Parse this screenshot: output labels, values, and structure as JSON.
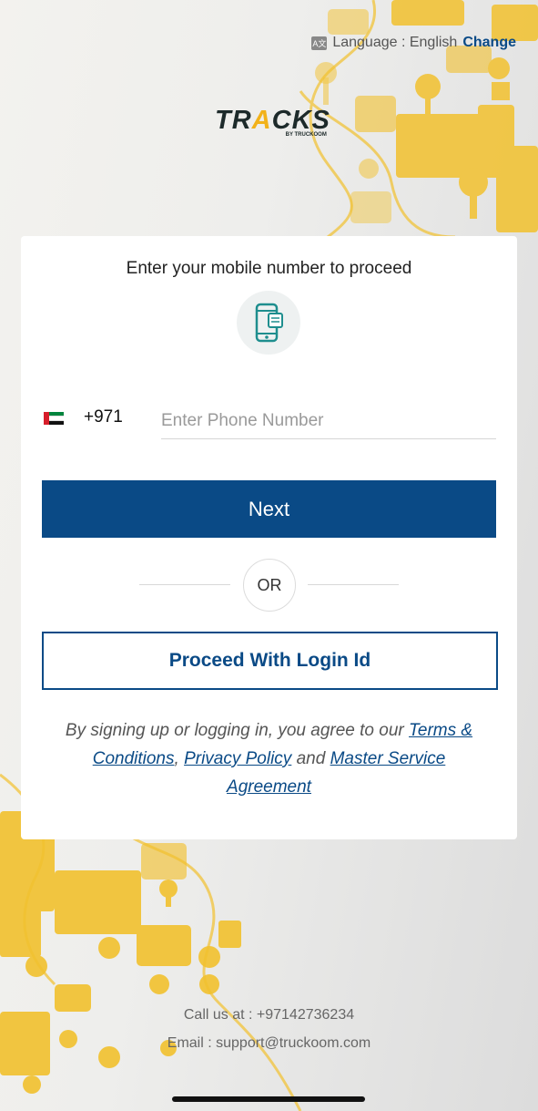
{
  "language": {
    "label": "Language : English",
    "change_label": "Change",
    "icon": "translate-icon"
  },
  "brand": {
    "word_pre": "TR",
    "word_a": "A",
    "word_post": "CKS",
    "sub": "BY TRUCKOOM",
    "accent": "#f2b21a"
  },
  "card": {
    "title": "Enter your mobile number to proceed",
    "phone_icon": "mobile-phone-icon",
    "country_code": "+971",
    "flag": "uae-flag",
    "phone_placeholder": "Enter Phone Number",
    "next_label": "Next",
    "or_label": "OR",
    "login_id_label": "Proceed With Login Id",
    "terms": {
      "prefix": "By signing up or logging in, you agree to our",
      "terms_link": "Terms & Conditions",
      "comma": ",",
      "privacy_link": "Privacy Policy",
      "and": "and",
      "msa_link": "Master Service Agreement"
    }
  },
  "footer": {
    "call": "Call us at : +97142736234",
    "email": "Email : support@truckoom.com"
  },
  "colors": {
    "primary": "#0a4a86",
    "accent": "#f2b21a"
  }
}
